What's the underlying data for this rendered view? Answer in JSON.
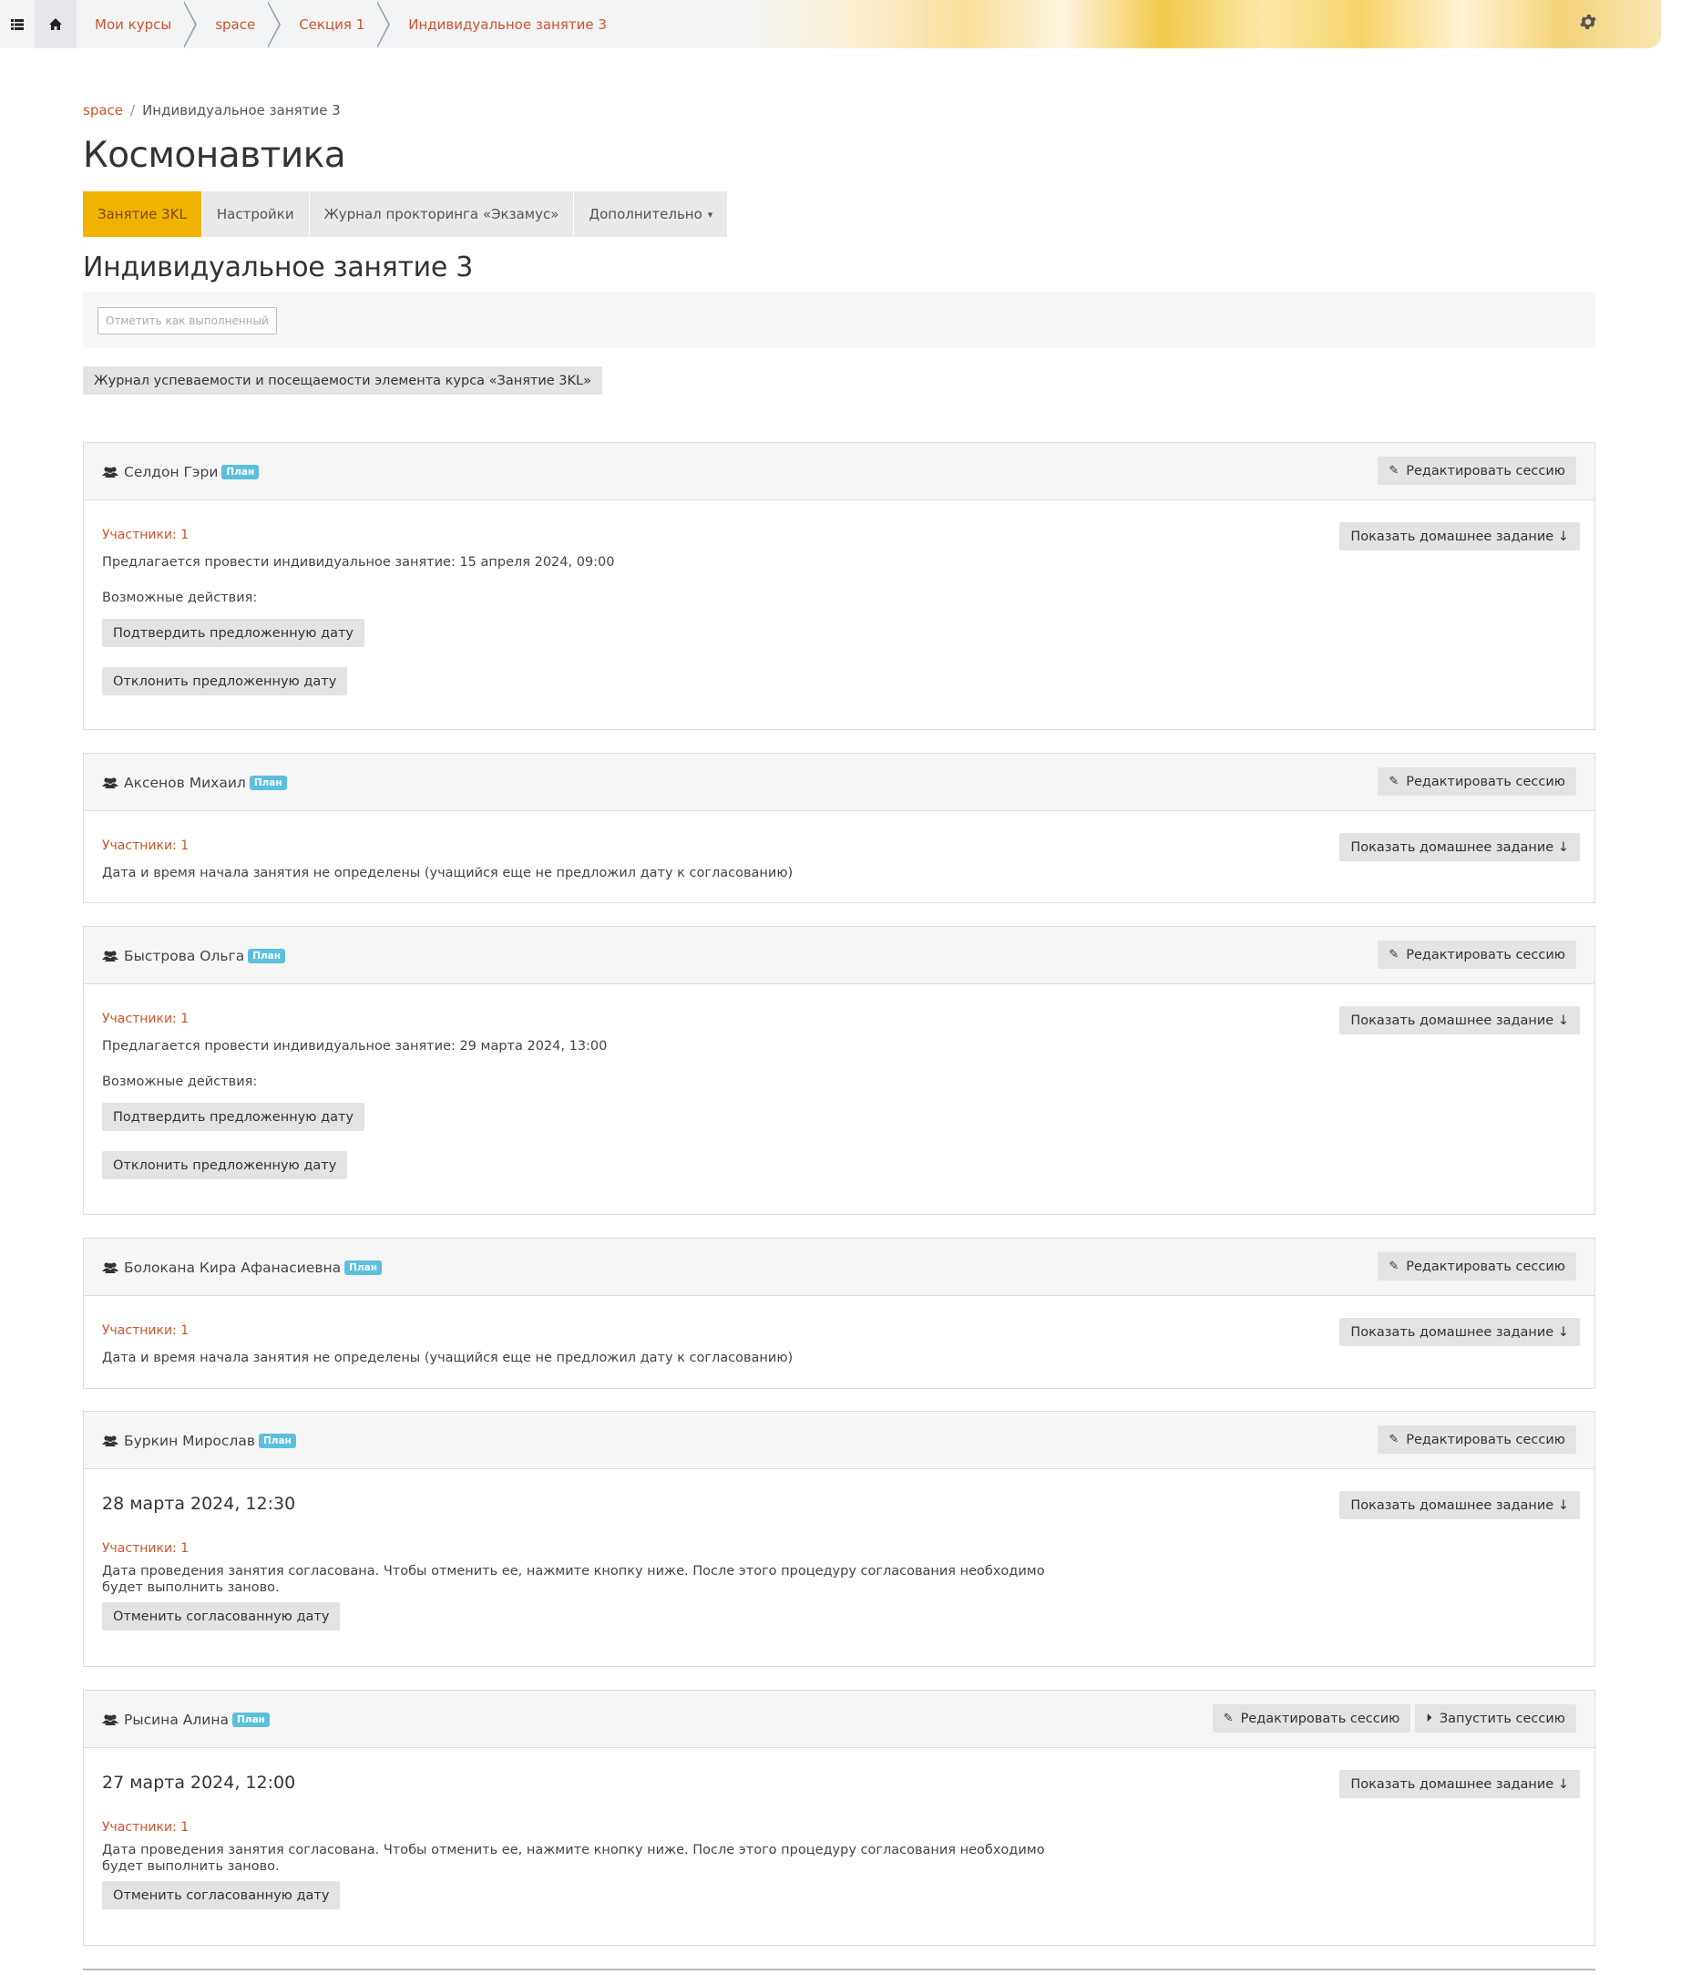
{
  "topbar": {
    "crumbs": [
      "Мои курсы",
      "space",
      "Секция 1",
      "Индивидуальное занятие 3"
    ],
    "icons": {
      "menu": "list-icon",
      "home": "home-icon",
      "settings": "gear-icon"
    }
  },
  "breadcrumb": {
    "link": "space",
    "current": "Индивидуальное занятие 3"
  },
  "course_title": "Космонавтика",
  "tabs": [
    {
      "label": "Занятие 3KL",
      "active": true
    },
    {
      "label": "Настройки"
    },
    {
      "label": "Журнал прокторинга «Экзамус»"
    },
    {
      "label": "Дополнительно"
    }
  ],
  "activity_title": "Индивидуальное занятие 3",
  "mark_complete_label": "Отметить как выполненный",
  "journal_button": "Журнал успеваемости и посещаемости элемента курса «Занятие 3KL»",
  "labels": {
    "edit_session": "Редактировать сессию",
    "start_session": "Запустить сессию",
    "show_homework": "Показать домашнее задание ↓",
    "plan_badge": "План",
    "possible_actions": "Возможные действия:",
    "confirm_date": "Подтвердить предложенную дату",
    "reject_date": "Отклонить предложенную дату",
    "cancel_agreed": "Отменить согласованную дату"
  },
  "sessions": [
    {
      "name": "Селдон Гэри",
      "participants": "Участники: 1",
      "text": "Предлагается провести индивидуальное занятие: 15 апреля 2024, 09:00"
    },
    {
      "name": "Аксенов Михаил",
      "participants": "Участники: 1",
      "text": "Дата и время начала занятия не определены (учащийся еще не предложил дату к согласованию)"
    },
    {
      "name": "Быстрова Ольга",
      "participants": "Участники: 1",
      "text": "Предлагается провести индивидуальное занятие: 29 марта 2024, 13:00"
    },
    {
      "name": "Болокана Кира Афанасиевна",
      "participants": "Участники: 1",
      "text": "Дата и время начала занятия не определены (учащийся еще не предложил дату к согласованию)"
    },
    {
      "name": "Буркин Мирослав",
      "participants": "Участники: 1",
      "date": "28 марта 2024, 12:30",
      "text": "Дата проведения занятия согласована. Чтобы отменить ее, нажмите кнопку ниже. После этого процедуру согласования необходимо будет выполнить заново."
    },
    {
      "name": "Рысина Алина",
      "participants": "Участники: 1",
      "date": "27 марта 2024, 12:00",
      "text": "Дата проведения занятия согласована. Чтобы отменить ее, нажмите кнопку ниже. После этого процедуру согласования необходимо будет выполнить заново."
    }
  ]
}
